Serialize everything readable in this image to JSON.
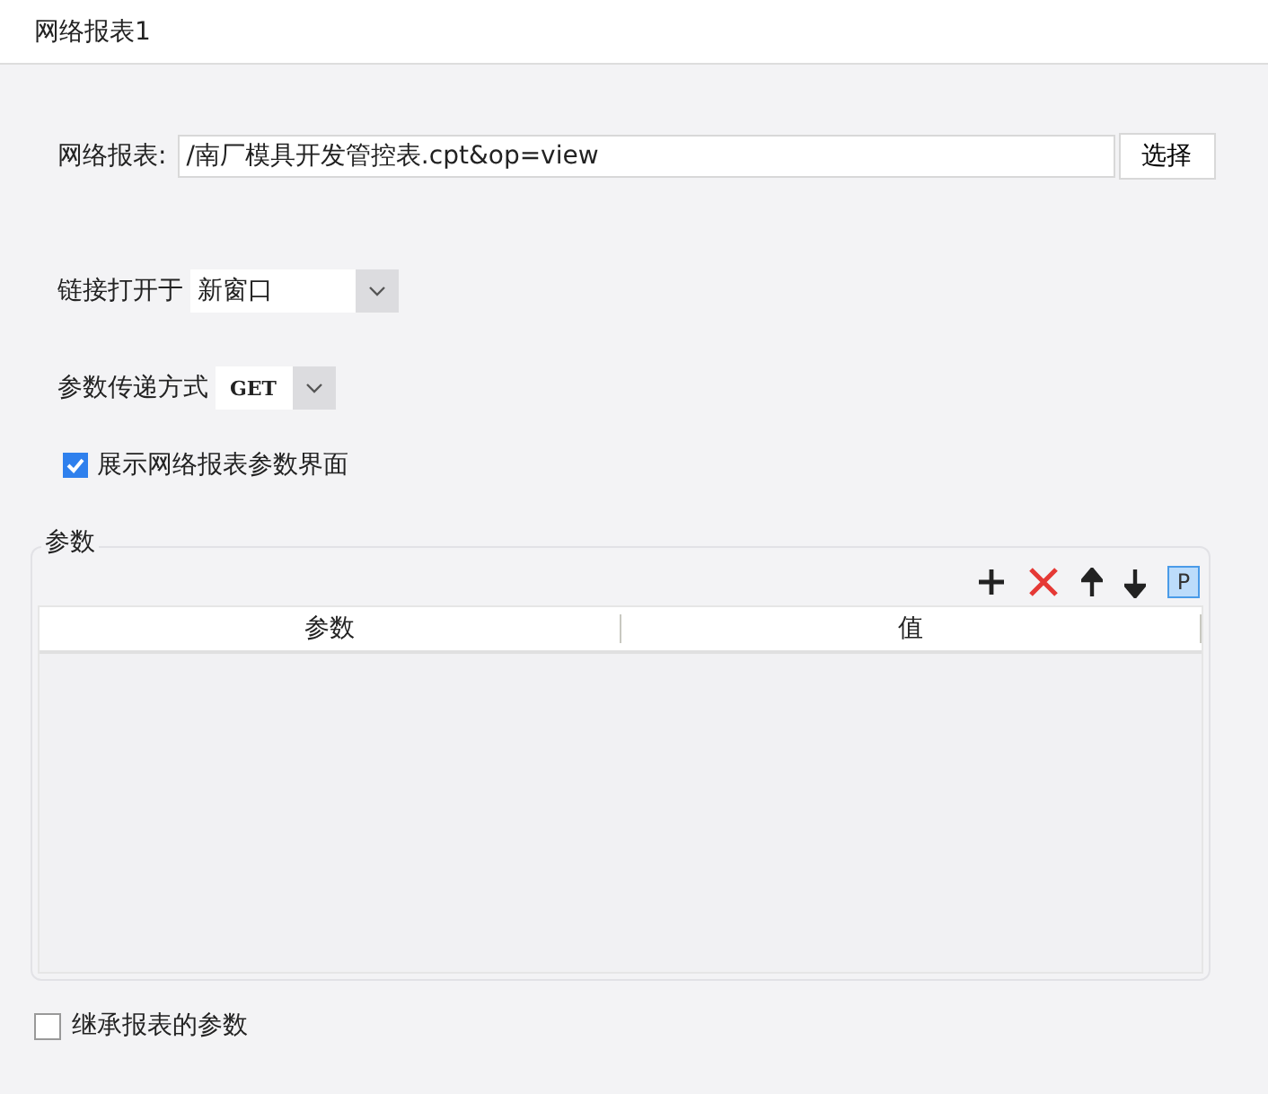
{
  "window": {
    "title": "网络报表1"
  },
  "report_field": {
    "label": "网络报表:",
    "value": "/南厂模具开发管控表.cpt&op=view",
    "button": "选择"
  },
  "open_in": {
    "label": "链接打开于",
    "value": "新窗口"
  },
  "pass_method": {
    "label": "参数传递方式",
    "value": "GET"
  },
  "show_params": {
    "label": "展示网络报表参数界面",
    "checked": true
  },
  "params": {
    "title": "参数",
    "toolbar": [
      {
        "kind": "add"
      },
      {
        "kind": "delete"
      },
      {
        "kind": "up"
      },
      {
        "kind": "down"
      },
      {
        "kind": "text",
        "label": "P"
      }
    ],
    "columns": [
      "参数",
      "值"
    ]
  },
  "inherit_params": {
    "label": "继承报表的参数",
    "checked": false
  }
}
